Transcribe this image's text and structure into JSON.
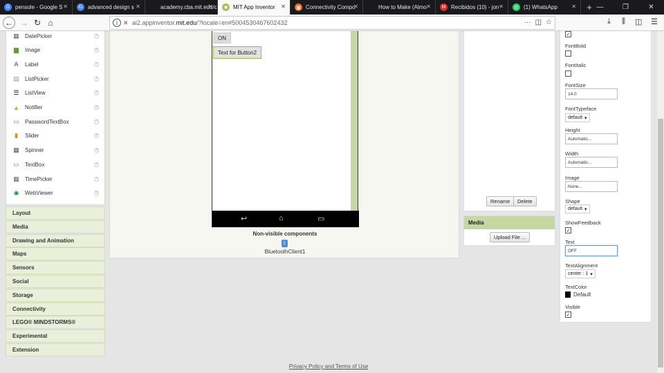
{
  "browser": {
    "tabs": [
      {
        "title": "pensole - Google S",
        "favicon": "google-g-icon",
        "color": "#4285f4",
        "glyph": "G"
      },
      {
        "title": "advanced design s",
        "favicon": "google-g-icon",
        "color": "#4285f4",
        "glyph": "G"
      },
      {
        "title": "academy.cba.mit.edu/cl",
        "favicon": "blank-page-icon",
        "color": "#1a1a1d",
        "glyph": ""
      },
      {
        "title": "MIT App Inventor",
        "favicon": "app-inventor-icon",
        "color": "#a8c24a",
        "glyph": "✱"
      },
      {
        "title": "Connectivity Compo",
        "favicon": "app-inventor-icon",
        "color": "#e06a2e",
        "glyph": "▦"
      },
      {
        "title": "How to Make (Almo",
        "favicon": "blank-page-icon",
        "color": "#1a1a1d",
        "glyph": ""
      },
      {
        "title": "Recibidos (10) - jon",
        "favicon": "gmail-icon",
        "color": "#d93025",
        "glyph": "M"
      },
      {
        "title": "(1) WhatsApp",
        "favicon": "whatsapp-icon",
        "color": "#25d366",
        "glyph": "✆"
      }
    ],
    "new_tab": "+",
    "window_controls": {
      "minimize": "—",
      "restore": "❐",
      "close": "✕"
    },
    "url_host": "ai2.appinventor.",
    "url_domain": "mit.edu",
    "url_path": "/?locale=en#5004530467602432",
    "more": "···"
  },
  "palette": {
    "items": [
      {
        "label": "DatePicker",
        "icon": "date-picker-icon",
        "glyph": "▦",
        "color": "#666"
      },
      {
        "label": "Image",
        "icon": "image-icon",
        "glyph": "▆",
        "color": "#6a9a3a"
      },
      {
        "label": "Label",
        "icon": "label-icon",
        "glyph": "A",
        "color": "#447"
      },
      {
        "label": "ListPicker",
        "icon": "list-picker-icon",
        "glyph": "▤",
        "color": "#999"
      },
      {
        "label": "ListView",
        "icon": "list-view-icon",
        "glyph": "☰",
        "color": "#111"
      },
      {
        "label": "Notifier",
        "icon": "notifier-icon",
        "glyph": "▲",
        "color": "#e0a020"
      },
      {
        "label": "PasswordTextBox",
        "icon": "password-textbox-icon",
        "glyph": "▭",
        "color": "#778"
      },
      {
        "label": "Slider",
        "icon": "slider-icon",
        "glyph": "▮",
        "color": "#d09020"
      },
      {
        "label": "Spinner",
        "icon": "spinner-icon",
        "glyph": "▦",
        "color": "#555"
      },
      {
        "label": "TextBox",
        "icon": "textbox-icon",
        "glyph": "▭",
        "color": "#777"
      },
      {
        "label": "TimePicker",
        "icon": "time-picker-icon",
        "glyph": "▦",
        "color": "#666"
      },
      {
        "label": "WebViewer",
        "icon": "web-viewer-icon",
        "glyph": "◉",
        "color": "#2a8a4a"
      }
    ],
    "help": "?",
    "categories": [
      "Layout",
      "Media",
      "Drawing and Animation",
      "Maps",
      "Sensors",
      "Social",
      "Storage",
      "Connectivity",
      "LEGO® MINDSTORMS®",
      "Experimental",
      "Extension"
    ]
  },
  "viewer": {
    "button_on": "ON",
    "button2": "Text for Button2",
    "nonvisible_title": "Non-visible components",
    "bluetooth_label": "BluetoothClient1",
    "nav_back": "↩",
    "nav_home": "⌂",
    "nav_recent": "▭"
  },
  "components": {
    "rename": "Rename",
    "delete": "Delete",
    "media_title": "Media",
    "upload": "Upload File ..."
  },
  "properties": {
    "font_bold": "FontBold",
    "font_italic": "FontItalic",
    "font_size": "FontSize",
    "font_size_value": "14.0",
    "font_typeface": "FontTypeface",
    "font_typeface_value": "default",
    "height": "Height",
    "height_value": "Automatic...",
    "width": "Width",
    "width_value": "Automatic...",
    "image": "Image",
    "image_value": "None...",
    "shape": "Shape",
    "shape_value": "default",
    "show_feedback": "ShowFeedback",
    "text": "Text",
    "text_value": "OFF",
    "text_alignment": "TextAlignment",
    "text_alignment_value": "center : 1",
    "text_color": "TextColor",
    "text_color_value": "Default",
    "visible": "Visible",
    "check": "✓",
    "dropdown": "▾"
  },
  "footer": {
    "privacy": "Privacy Policy and Terms of Use"
  }
}
